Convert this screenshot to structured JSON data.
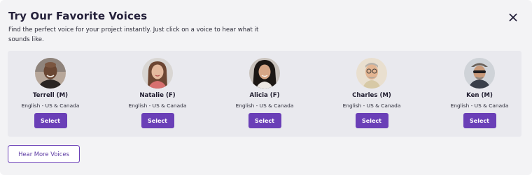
{
  "modal": {
    "title": "Try Our Favorite Voices",
    "description": "Find the perfect voice for your project instantly. Just click on a voice to hear what it sounds like.",
    "close_icon": "close-icon"
  },
  "voices": [
    {
      "name": "Terrell (M)",
      "language": "English - US & Canada",
      "button": "Select"
    },
    {
      "name": "Natalie (F)",
      "language": "English - US & Canada",
      "button": "Select"
    },
    {
      "name": "Alicia (F)",
      "language": "English - US & Canada",
      "button": "Select"
    },
    {
      "name": "Charles (M)",
      "language": "English - US & Canada",
      "button": "Select"
    },
    {
      "name": "Ken (M)",
      "language": "English - US & Canada",
      "button": "Select"
    }
  ],
  "footer": {
    "hear_more_label": "Hear More Voices"
  },
  "colors": {
    "accent": "#6a3fb7",
    "panel_background": "#e9e9ee",
    "modal_background": "#f3f3f5"
  }
}
